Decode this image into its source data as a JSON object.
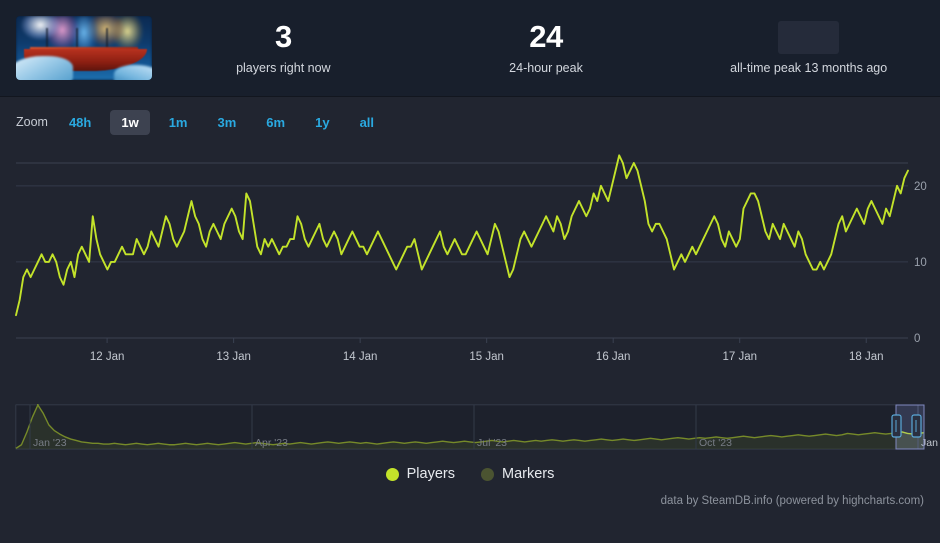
{
  "header": {
    "game_thumbnail": "game-capsule-image",
    "stats": [
      {
        "value": "3",
        "label": "players right now",
        "hidden": false
      },
      {
        "value": "24",
        "label": "24-hour peak",
        "hidden": false
      },
      {
        "value": "",
        "label": "all-time peak 13 months ago",
        "hidden": true
      }
    ]
  },
  "range_selector": {
    "zoom_label": "Zoom",
    "buttons": [
      {
        "label": "48h",
        "active": false
      },
      {
        "label": "1w",
        "active": true
      },
      {
        "label": "1m",
        "active": false
      },
      {
        "label": "3m",
        "active": false
      },
      {
        "label": "6m",
        "active": false
      },
      {
        "label": "1y",
        "active": false
      },
      {
        "label": "all",
        "active": false
      }
    ]
  },
  "legend": {
    "items": [
      {
        "label": "Players",
        "color": "#c3e32a",
        "active": true
      },
      {
        "label": "Markers",
        "color": "#4b5431",
        "active": false
      }
    ]
  },
  "footer": {
    "credit": "data by SteamDB.info (powered by highcharts.com)"
  },
  "colors": {
    "series_line": "#c3e32a",
    "header_bg": "#181f2c",
    "chart_bg": "#212530",
    "gridline": "#333a4a",
    "accent_link": "#2aa9e0",
    "active_button_bg": "#3d4250"
  },
  "chart_data": {
    "type": "line",
    "title": "",
    "subtitle": "",
    "xlabel": "",
    "ylabel": "",
    "grid": true,
    "legend_position": "bottom",
    "ylim": [
      0,
      23
    ],
    "yticks": [
      0,
      10,
      20
    ],
    "xticks": [
      "12 Jan",
      "13 Jan",
      "14 Jan",
      "15 Jan",
      "16 Jan",
      "17 Jan",
      "18 Jan"
    ],
    "x_range": [
      "11 Jan",
      "18 Jan"
    ],
    "series": [
      {
        "name": "Players",
        "color": "#c3e32a",
        "values": [
          3,
          5,
          8,
          9,
          8,
          9,
          10,
          11,
          10,
          10,
          11,
          10,
          8,
          7,
          9,
          10,
          8,
          11,
          12,
          11,
          10,
          16,
          13,
          11,
          10,
          9,
          10,
          10,
          11,
          12,
          11,
          11,
          11,
          13,
          12,
          11,
          12,
          14,
          13,
          12,
          14,
          16,
          15,
          13,
          12,
          13,
          14,
          16,
          18,
          16,
          15,
          13,
          12,
          14,
          15,
          14,
          13,
          15,
          16,
          17,
          16,
          14,
          13,
          19,
          18,
          15,
          12,
          11,
          13,
          12,
          13,
          12,
          11,
          12,
          12,
          13,
          13,
          16,
          15,
          13,
          12,
          13,
          14,
          15,
          13,
          12,
          13,
          14,
          13,
          11,
          12,
          13,
          14,
          13,
          12,
          12,
          11,
          12,
          13,
          14,
          13,
          12,
          11,
          10,
          9,
          10,
          11,
          12,
          12,
          13,
          11,
          9,
          10,
          11,
          12,
          13,
          14,
          12,
          11,
          12,
          13,
          12,
          11,
          11,
          12,
          13,
          14,
          13,
          12,
          11,
          13,
          15,
          14,
          12,
          10,
          8,
          9,
          11,
          13,
          14,
          13,
          12,
          13,
          14,
          15,
          16,
          15,
          14,
          16,
          15,
          13,
          14,
          16,
          17,
          18,
          17,
          16,
          17,
          19,
          18,
          20,
          19,
          18,
          20,
          22,
          24,
          23,
          21,
          22,
          23,
          22,
          20,
          18,
          15,
          14,
          15,
          15,
          14,
          13,
          11,
          9,
          10,
          11,
          10,
          11,
          12,
          11,
          12,
          13,
          14,
          15,
          16,
          15,
          13,
          12,
          14,
          13,
          12,
          13,
          17,
          18,
          19,
          19,
          18,
          16,
          14,
          13,
          15,
          14,
          13,
          15,
          14,
          13,
          12,
          14,
          13,
          11,
          10,
          9,
          9,
          10,
          9,
          10,
          11,
          13,
          15,
          16,
          14,
          15,
          16,
          17,
          16,
          15,
          17,
          18,
          17,
          16,
          15,
          17,
          16,
          18,
          20,
          19,
          21,
          22
        ]
      }
    ],
    "navigator": {
      "xticks": [
        "Jan '23",
        "Apr '23",
        "Jul '23",
        "Oct '23",
        "Jan"
      ],
      "selected_range_label": "1w",
      "values": [
        1,
        6,
        24,
        45,
        62,
        50,
        34,
        26,
        21,
        17,
        14,
        12,
        10,
        9,
        8,
        8,
        7,
        7,
        8,
        7,
        6,
        7,
        8,
        7,
        6,
        7,
        8,
        7,
        6,
        6,
        7,
        8,
        7,
        6,
        7,
        8,
        7,
        6,
        7,
        8,
        9,
        8,
        7,
        8,
        9,
        8,
        7,
        6,
        7,
        8,
        7,
        8,
        9,
        8,
        7,
        8,
        9,
        10,
        9,
        8,
        9,
        10,
        9,
        8,
        9,
        8,
        7,
        8,
        9,
        10,
        9,
        8,
        9,
        10,
        9,
        8,
        9,
        10,
        11,
        10,
        9,
        10,
        11,
        10,
        9,
        10,
        11,
        12,
        11,
        10,
        11,
        12,
        11,
        10,
        11,
        12,
        11,
        12,
        13,
        12,
        11,
        12,
        13,
        12,
        11,
        12,
        13,
        14,
        13,
        12,
        13,
        14,
        13,
        12,
        13,
        14,
        15,
        14,
        13,
        14,
        15,
        16,
        15,
        14,
        15,
        16,
        15,
        16,
        17,
        16,
        15,
        16,
        17,
        18,
        17,
        16,
        17,
        18,
        19,
        18,
        17,
        18,
        19,
        20,
        19,
        18,
        19,
        20,
        21,
        20,
        19,
        20,
        22,
        21,
        20,
        21,
        22,
        23,
        22,
        21,
        22,
        23,
        24,
        22,
        21,
        22,
        23
      ]
    }
  }
}
